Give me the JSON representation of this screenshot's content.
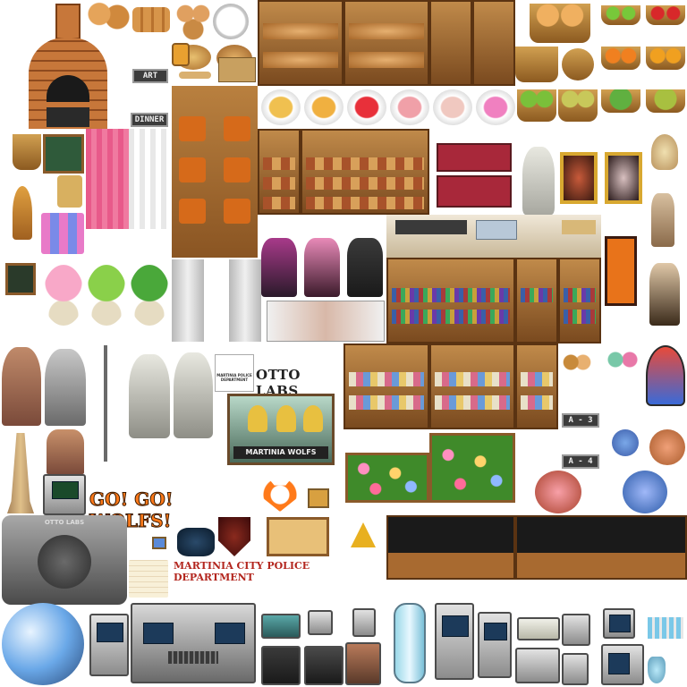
{
  "signs": {
    "art": "ART",
    "dinner": "DINNER",
    "otto_labs": "OTTO LABS",
    "otto_labs_sign_small": "OTTO LABS",
    "martinia_police_badge": "MARTINIA POLICE DEPARTMENT",
    "martinia_wolfs": "MARTINIA WOLFS",
    "go_go_wolfs": "GO! GO! WOLFS!",
    "martinia_city_police": "MARTINIA CITY POLICE DEPARTMENT",
    "room_a3": "A - 3",
    "room_a4": "A - 4"
  },
  "colors": {
    "wood": "#8a5523",
    "brick": "#c7773a",
    "wolfs_orange": "#ff7a1a",
    "police_red": "#b3261e",
    "banner_orange": "#e8731a"
  },
  "icons": [
    "brick-oven-icon",
    "bread-loaf-icon",
    "baguette-icon",
    "pie-icon",
    "cake-icon",
    "fruit-basket-icon",
    "potted-plant-icon",
    "skeleton-icon",
    "portrait-icon",
    "mannequin-icon",
    "jukebox-icon",
    "trophy-icon",
    "wolf-mascot-icon",
    "police-shield-icon",
    "computer-terminal-icon",
    "glass-tube-icon",
    "atom-emblem-icon"
  ]
}
